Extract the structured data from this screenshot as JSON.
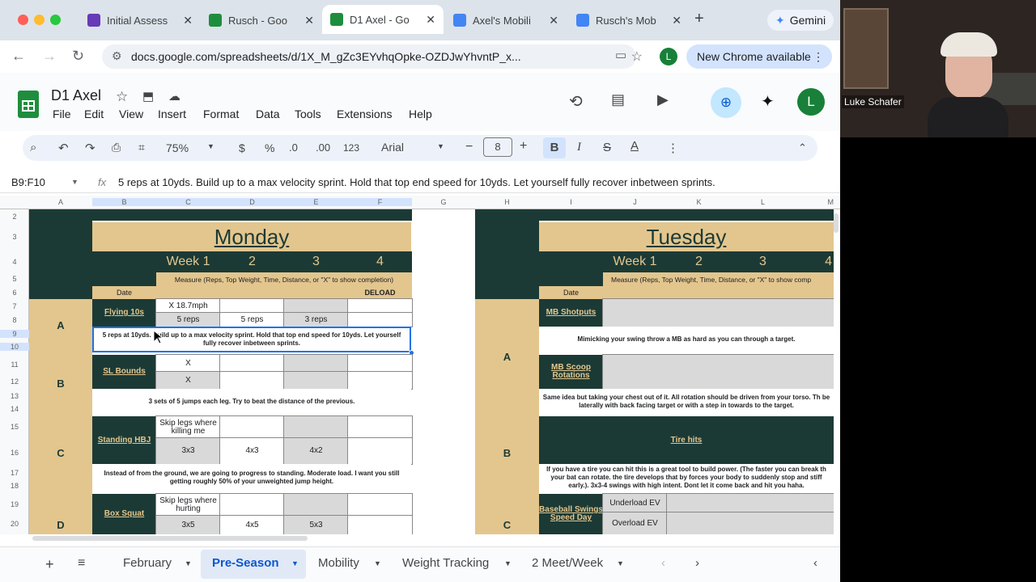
{
  "browser": {
    "tabs": [
      {
        "label": "Initial Assess"
      },
      {
        "label": "Rusch - Goo"
      },
      {
        "label": "D1 Axel - Go"
      },
      {
        "label": "Axel's Mobili"
      },
      {
        "label": "Rusch's Mob"
      }
    ],
    "gemini": "Gemini",
    "url": "docs.google.com/spreadsheets/d/1X_M_gZc3EYvhqOpke-OZDJwYhvntP_x...",
    "profile_letter": "L",
    "update_label": "New Chrome available"
  },
  "sheets": {
    "title": "D1 Axel",
    "menus": [
      "File",
      "Edit",
      "View",
      "Insert",
      "Format",
      "Data",
      "Tools",
      "Extensions",
      "Help"
    ],
    "zoom": "75%",
    "currency": "$",
    "percent": "%",
    "dec_less": ".0",
    "dec_more": ".00",
    "num_fmt": "123",
    "font": "Arial",
    "font_size": "8",
    "account_letter": "L",
    "name_box": "B9:F10",
    "formula": "5 reps at 10yds. Build up to a max velocity sprint. Hold that top end speed for 10yds. Let yourself fully recover inbetween sprints."
  },
  "columns": [
    "A",
    "B",
    "C",
    "D",
    "E",
    "F",
    "G",
    "H",
    "I",
    "J",
    "K",
    "L",
    "M"
  ],
  "rows": [
    "2",
    "3",
    "4",
    "5",
    "6",
    "7",
    "8",
    "9",
    "10",
    "11",
    "12",
    "13",
    "14",
    "15",
    "16",
    "17",
    "18",
    "19",
    "20"
  ],
  "monday": {
    "day": "Monday",
    "week1": "Week 1",
    "w2": "2",
    "w3": "3",
    "w4": "4",
    "measure": "Measure (Reps, Top Weight, Time, Distance, or \"X\" to show completion)",
    "date": "Date",
    "deload": "DELOAD",
    "a": "A",
    "flying": "Flying 10s",
    "flying_c1": "X 18.7mph",
    "flying_c2": "5 reps",
    "flying_d2": "5 reps",
    "flying_e2": "3 reps",
    "flying_note": "5 reps at 10yds. Build up to a max velocity sprint. Hold that top end speed for 10yds. Let yourself fully recover inbetween sprints.",
    "b": "B",
    "sl": "SL Bounds",
    "sl_c1": "X",
    "sl_c2": "X",
    "sl_note": "3 sets of 5 jumps each leg. Try to beat the distance of the previous.",
    "c": "C",
    "hbj": "Standing HBJ",
    "hbj_c1": "Skip legs where killing me",
    "hbj_c2": "3x3",
    "hbj_d2": "4x3",
    "hbj_e2": "4x2",
    "hbj_note": "Instead of from the ground, we are going to progress to standing. Moderate load. I want you still getting roughly 50% of your unweighted jump height.",
    "d": "D",
    "box": "Box Squat",
    "box_c1": "Skip legs where hurting",
    "box_c2": "3x5",
    "box_d2": "4x5",
    "box_e2": "5x3"
  },
  "tuesday": {
    "day": "Tuesday",
    "week1": "Week 1",
    "w2": "2",
    "w3": "3",
    "w4": "4",
    "measure": "Measure (Reps, Top Weight, Time, Distance, or \"X\" to show comp",
    "date": "Date",
    "a": "A",
    "mbs": "MB Shotputs",
    "mbs_note": "Mimicking your swing throw a MB as hard as you can through a target.",
    "mbr": "MB Scoop Rotations",
    "mbr_note": "Same idea but taking your chest out of it. All rotation should be driven from your torso. Th be laterally with back facing target or with a step in towards to the target.",
    "b": "B",
    "tire": "Tire hits",
    "tire_note": "If you have a tire you can hit this is a great tool to build power. (The faster you can break th your bat can rotate. the tire develops that by forces your body to suddenly stop and stiff early.). 3x3-4 swings with high intent. Dont let it come back and hit you haha.",
    "c": "C",
    "bsd": "Baseball Swings Speed Day",
    "under": "Underload EV",
    "over": "Overload EV"
  },
  "sheet_tabs": [
    "February",
    "Pre-Season",
    "Mobility",
    "Weight Tracking",
    "2 Meet/Week"
  ],
  "video": {
    "name": "Luke Schafer"
  }
}
